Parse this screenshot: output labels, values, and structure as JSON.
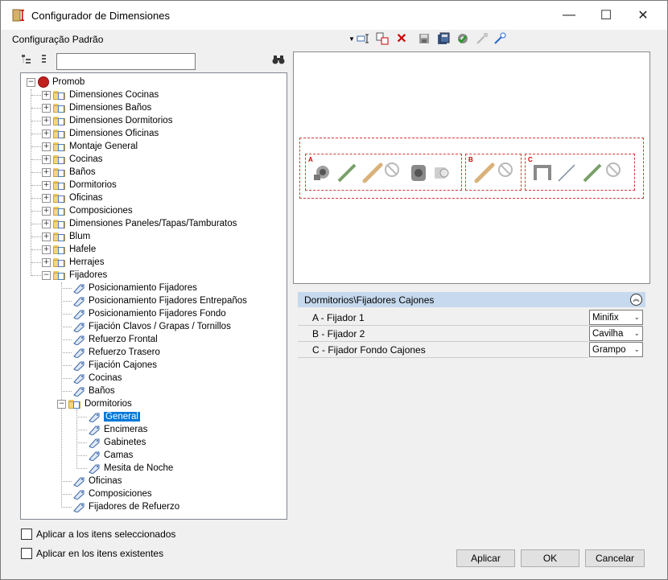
{
  "window": {
    "title": "Configurador de Dimensiones",
    "minimize": "—",
    "maximize": "☐",
    "close": "✕"
  },
  "toolbar": {
    "config_label": "Configuração Padrão"
  },
  "tree": {
    "root": "Promob",
    "folders": [
      "Dimensiones Cocinas",
      "Dimensiones Baños",
      "Dimensiones Dormitorios",
      "Dimensiones Oficinas",
      "Montaje General",
      "Cocinas",
      "Baños",
      "Dormitorios",
      "Oficinas",
      "Composiciones",
      "Dimensiones Paneles/Tapas/Tamburatos",
      "Blum",
      "Hafele",
      "Herrajes",
      "Fijadores"
    ],
    "fijadores_children": [
      "Posicionamiento Fijadores",
      "Posicionamiento Fijadores Entrepaños",
      "Posicionamiento Fijadores Fondo",
      "Fijación Clavos / Grapas / Tornillos",
      "Refuerzo Frontal",
      "Refuerzo Trasero",
      "Fijación Cajones",
      "Cocinas",
      "Baños"
    ],
    "dormitorios_folder": "Dormitorios",
    "dormitorios_children": [
      "General",
      "Encimeras",
      "Gabinetes",
      "Camas",
      "Mesita de Noche"
    ],
    "fijadores_tail": [
      "Oficinas",
      "Composiciones",
      "Fijadores de Refuerzo"
    ]
  },
  "preview": {
    "groups": [
      "A",
      "B",
      "C"
    ]
  },
  "properties": {
    "header": "Dormitorios\\Fijadores Cajones",
    "rows": [
      {
        "name": "A - Fijador 1",
        "value": "Minifix"
      },
      {
        "name": "B - Fijador 2",
        "value": "Cavilha"
      },
      {
        "name": "C - Fijador Fondo Cajones",
        "value": "Grampo"
      }
    ]
  },
  "options": {
    "apply_selected": "Aplicar a los itens seleccionados",
    "apply_existing": "Aplicar en los itens existentes"
  },
  "buttons": {
    "apply": "Aplicar",
    "ok": "OK",
    "cancel": "Cancelar"
  },
  "colors": {
    "selection": "#0078d7",
    "header_bg": "#c6d9ee",
    "group_border": "#d23a3a"
  }
}
